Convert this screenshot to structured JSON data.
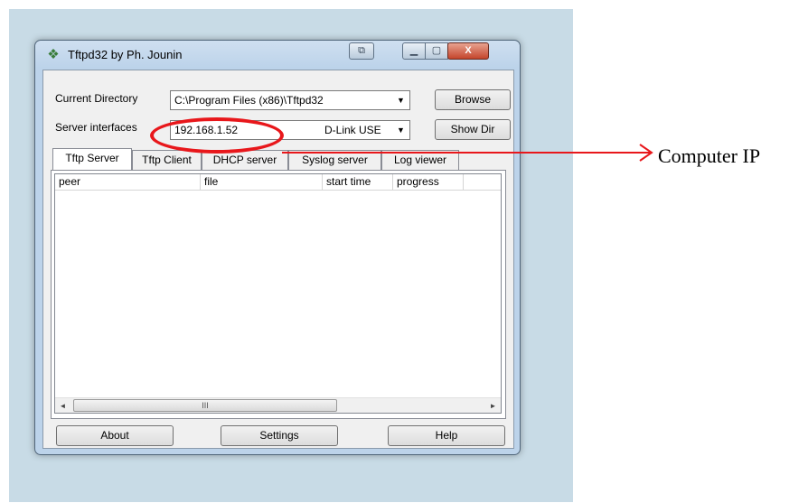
{
  "window": {
    "title": "Tftpd32 by Ph. Jounin",
    "icon": "network-icon",
    "close_glyph": "X",
    "min_glyph": "▁",
    "max_glyph": "▢",
    "restore_glyph": "⧉"
  },
  "directory": {
    "label": "Current Directory",
    "value": "C:\\Program Files (x86)\\Tftpd32",
    "browse_label": "Browse"
  },
  "interfaces": {
    "label": "Server interfaces",
    "ip": "192.168.1.52",
    "adapter": "D-Link USE",
    "showdir_label": "Show Dir"
  },
  "tabs": [
    {
      "label": "Tftp Server",
      "active": true
    },
    {
      "label": "Tftp Client",
      "active": false
    },
    {
      "label": "DHCP server",
      "active": false
    },
    {
      "label": "Syslog server",
      "active": false
    },
    {
      "label": "Log viewer",
      "active": false
    }
  ],
  "table": {
    "columns": [
      "peer",
      "file",
      "start time",
      "progress"
    ],
    "rows": []
  },
  "scrollbar": {
    "left_arrow": "◄",
    "right_arrow": "►",
    "grip": "III"
  },
  "footer": {
    "about_label": "About",
    "settings_label": "Settings",
    "help_label": "Help"
  },
  "annotation": {
    "label": "Computer IP",
    "color": "#e8171b"
  }
}
